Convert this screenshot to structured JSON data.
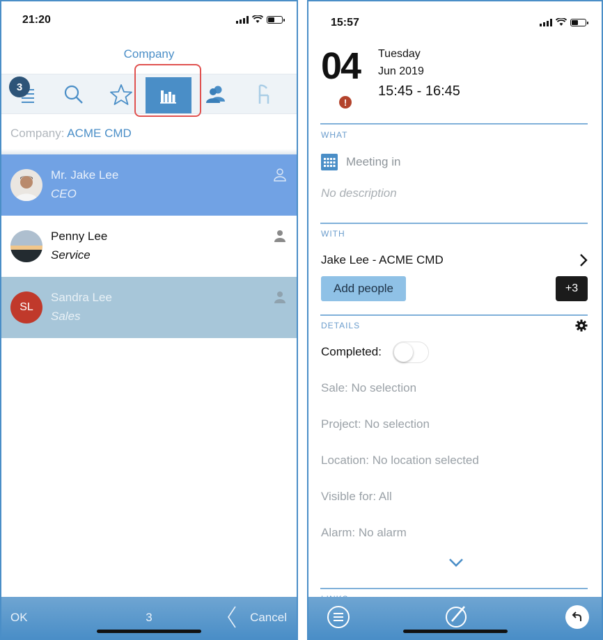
{
  "left": {
    "status_time": "21:20",
    "title": "Company",
    "badge_count": "3",
    "tabs": [
      {
        "icon": "list-icon"
      },
      {
        "icon": "search-icon"
      },
      {
        "icon": "star-icon"
      },
      {
        "icon": "bar-chart-icon",
        "active": true
      },
      {
        "icon": "people-icon"
      },
      {
        "icon": "chair-icon"
      }
    ],
    "filter": {
      "label": "Company:",
      "value": "ACME CMD"
    },
    "contacts": [
      {
        "name": "Mr. Jake Lee",
        "role": "CEO",
        "avatar": "photo"
      },
      {
        "name": "Penny Lee",
        "role": "Service",
        "avatar": "photo"
      },
      {
        "name": "Sandra Lee",
        "role": "Sales",
        "avatar": "initials",
        "initials": "SL"
      }
    ],
    "bottom": {
      "ok": "OK",
      "count": "3",
      "cancel": "Cancel"
    }
  },
  "right": {
    "status_time": "15:57",
    "date": {
      "day_num": "04",
      "weekday": "Tuesday",
      "month_year": "Jun 2019",
      "time_range": "15:45 - 16:45"
    },
    "what": {
      "label": "WHAT",
      "meeting": "Meeting in",
      "description": "No description"
    },
    "with": {
      "label": "WITH",
      "person": "Jake Lee - ACME CMD",
      "add_people": "Add people",
      "more_count": "+3"
    },
    "details": {
      "label": "DETAILS",
      "completed_label": "Completed:",
      "completed": false,
      "rows": [
        {
          "label": "Sale:",
          "value": "No selection"
        },
        {
          "label": "Project:",
          "value": "No selection"
        },
        {
          "label": "Location:",
          "value": "No location selected"
        },
        {
          "label": "Visible for:",
          "value": "All"
        },
        {
          "label": "Alarm:",
          "value": "No alarm"
        }
      ]
    },
    "links_label": "LINKS"
  },
  "colors": {
    "accent": "#4a8ec7",
    "selected_row": "#71a2e4",
    "secondary_row": "#a7c6d9",
    "highlight_box": "#e0514f"
  }
}
